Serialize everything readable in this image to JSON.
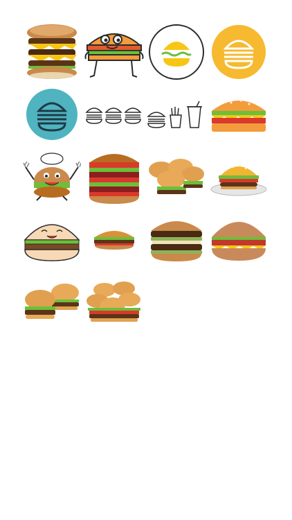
{
  "app": {
    "title": ""
  },
  "sticker_grid": {
    "items": [
      {
        "icon": "triple-cheeseburger-icon"
      },
      {
        "icon": "cartoon-burger-face-icon"
      },
      {
        "icon": "burger-circle-outline-icon"
      },
      {
        "icon": "burger-yellow-circle-icon"
      },
      {
        "icon": "burger-teal-circle-icon"
      },
      {
        "icon": "three-burgers-outline-icon"
      },
      {
        "icon": "burger-fries-drink-outline-icon"
      },
      {
        "icon": "flat-cheeseburger-icon"
      },
      {
        "icon": "chef-burger-mascot-icon"
      },
      {
        "icon": "tall-stacked-burger-icon"
      },
      {
        "icon": "burger-sliders-icon"
      },
      {
        "icon": "burger-on-plate-icon"
      },
      {
        "icon": "smiling-burger-face-icon"
      },
      {
        "icon": "small-burger-icon"
      },
      {
        "icon": "double-burger-lettuce-icon"
      },
      {
        "icon": "flat-brown-burger-icon"
      },
      {
        "icon": "burger-pair-icon"
      },
      {
        "icon": "burger-group-icon"
      }
    ]
  },
  "colors": {
    "background": "#ffffff",
    "bun": "#d9923a",
    "bun_dark": "#b86c1f",
    "patty": "#5b3418",
    "cheese": "#f7c615",
    "lettuce": "#6cbf3a",
    "tomato": "#d93a2b",
    "yellow_circle": "#f6b930",
    "teal_circle": "#4fb3c0",
    "flat_orange": "#f39c3d",
    "line": "#2a2a2a"
  }
}
